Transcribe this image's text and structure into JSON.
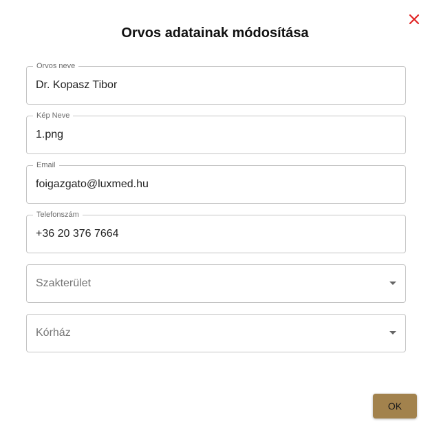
{
  "dialog": {
    "title": "Orvos adatainak módosítása",
    "close_icon": "close-icon",
    "close_color": "#e02424"
  },
  "form": {
    "name": {
      "label": "Orvos neve",
      "value": "Dr. Kopasz Tibor"
    },
    "image": {
      "label": "Kép Neve",
      "value": "1.png"
    },
    "email": {
      "label": "Email",
      "value": "foigazgato@luxmed.hu"
    },
    "phone": {
      "label": "Telefonszám",
      "value": "+36 20 376 7664"
    },
    "specialty": {
      "placeholder": "Szakterület",
      "icon": "chevron-down-icon"
    },
    "hospital": {
      "placeholder": "Kórház",
      "icon": "chevron-down-icon"
    }
  },
  "actions": {
    "ok_label": "OK",
    "ok_color": "#a2824d"
  }
}
